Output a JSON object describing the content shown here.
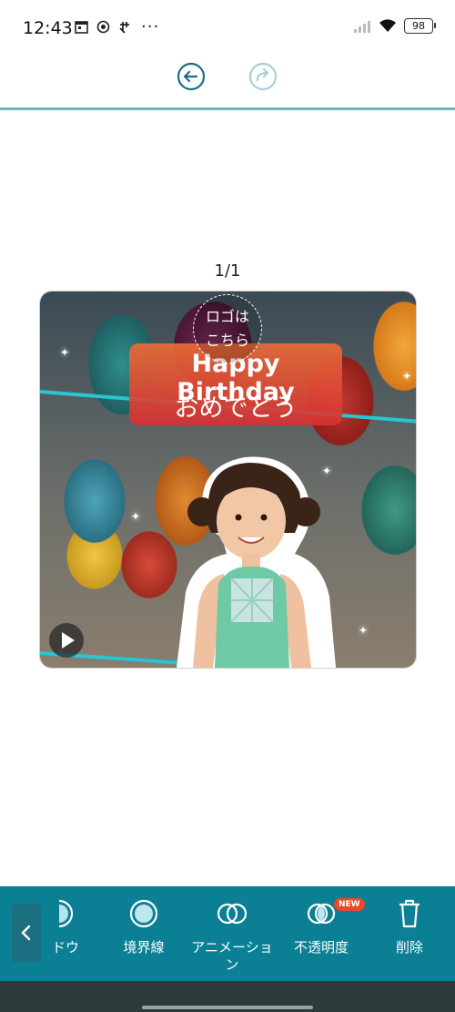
{
  "status_bar": {
    "time": "12:43",
    "left_icons": [
      "calendar-icon",
      "target-icon",
      "sync-icon",
      "more-dots-icon"
    ],
    "more_dots": "···",
    "battery": "98"
  },
  "header": {
    "undo_icon": "undo-arrow-icon",
    "redo_icon": "redo-arrow-icon"
  },
  "page_indicator": "1/1",
  "canvas": {
    "logo_placeholder_line1": "ロゴは",
    "logo_placeholder_line2": "こちら",
    "title_line1": "Happy Birthday",
    "title_line2": "おめでとう",
    "colors": {
      "title_box": "#e05a3a",
      "accent_line": "#27c6d2"
    }
  },
  "toolbar": {
    "background": "#0b7f94",
    "tools": [
      {
        "icon": "shadow-icon",
        "label": "ドウ"
      },
      {
        "icon": "border-circle-icon",
        "label": "境界線"
      },
      {
        "icon": "animation-icon",
        "label": "アニメーション"
      },
      {
        "icon": "opacity-icon",
        "label": "不透明度",
        "badge": "NEW"
      },
      {
        "icon": "trash-icon",
        "label": "削除"
      }
    ]
  }
}
